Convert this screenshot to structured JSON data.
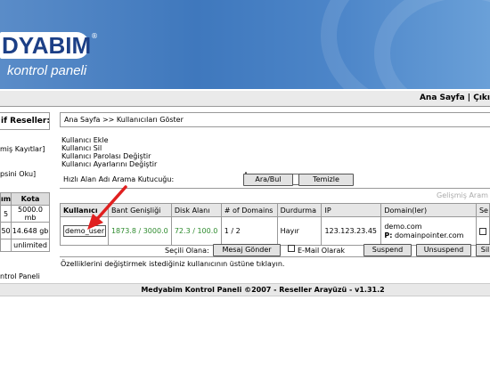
{
  "header": {
    "logo_text": "DYABIM",
    "logo_reg": "®",
    "logo_subtitle": "kontrol paneli"
  },
  "topnav": {
    "home": "Ana Sayfa",
    "separator": " | ",
    "logout": "Çıkı"
  },
  "left": {
    "title": "if Reseller:",
    "links": [
      "miş Kayıtlar]",
      "psini Oku]"
    ],
    "table": {
      "headers": [
        "ım",
        "Kota"
      ],
      "rows": [
        [
          "5",
          "5000.0 mb"
        ],
        [
          "50",
          "14.648 gb"
        ],
        [
          "",
          "unlimited"
        ]
      ]
    },
    "footer_link": "ntrol Paneli"
  },
  "breadcrumb": "Ana Sayfa >> Kullanıcıları Göster",
  "menu": [
    "Kullanıcı Ekle",
    "Kullanıcı Sil",
    "Kullanıcı Parolası Değiştir",
    "Kullanıcı Ayarlarını Değiştir"
  ],
  "search": {
    "label": "Hızlı Alan Adı Arama Kutucuğu:",
    "value": "",
    "search_button": "Ara/Bul",
    "clear_button": "Temizle"
  },
  "advanced_search": "Gelişmiş Aram",
  "table": {
    "headers": [
      "Kullanıcı",
      "Bant Genişliği",
      "Disk Alanı",
      "# of Domains",
      "Durdurma",
      "IP",
      "Domain(ler)",
      "Se"
    ],
    "rows": [
      {
        "user": "demo_user",
        "bandwidth": "1873.8 / 3000.0",
        "disk": "72.3 / 100.0",
        "domains": "1 / 2",
        "suspended": "Hayır",
        "ip": "123.123.23.45",
        "domain_line1": "demo.com",
        "domain_line2_label": "P:",
        "domain_line2": "domainpointer.com"
      }
    ]
  },
  "actions": {
    "selected_label": "Seçili Olana:",
    "message_button": "Mesaj Gönder",
    "email_label": "E-Mail Olarak",
    "suspend_button": "Suspend",
    "unsuspend_button": "Unsuspend",
    "delete_button": "Sil"
  },
  "note": "Özelliklerini değiştirmek istediğiniz kullanıcının üstüne tıklayın.",
  "footer": "Medyabim Kontrol Paneli ©2007 - Reseller Arayüzü - v1.31.2",
  "colors": {
    "header": "#3f78bd",
    "logo_text": "#1c3f86",
    "usage_green": "#2e8b2e",
    "arrow": "#e02020"
  }
}
